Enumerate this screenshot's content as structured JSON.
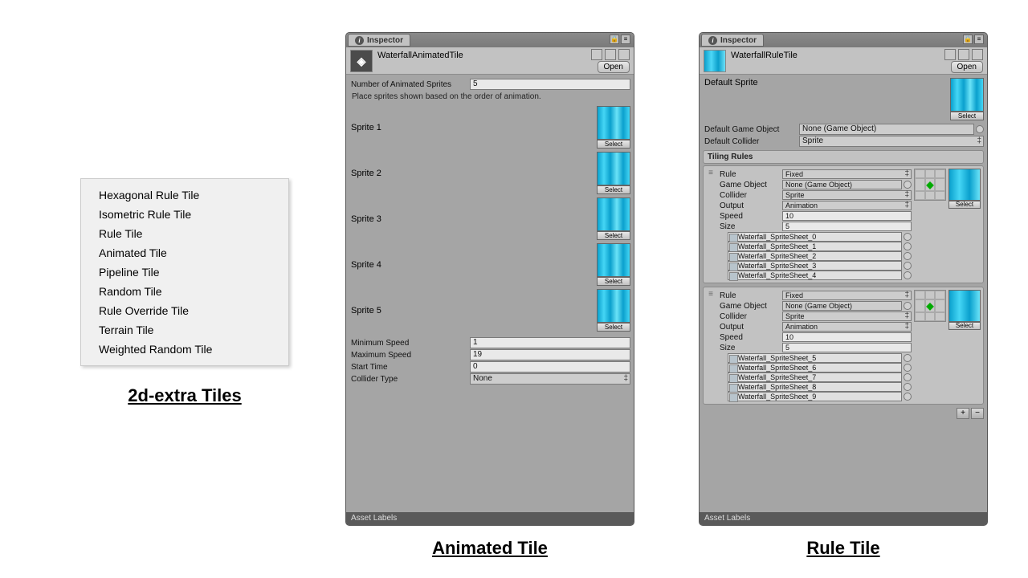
{
  "menu": {
    "items": [
      "Hexagonal Rule Tile",
      "Isometric Rule Tile",
      "Rule Tile",
      "Animated Tile",
      "Pipeline Tile",
      "Random Tile",
      "Rule Override Tile",
      "Terrain Tile",
      "Weighted Random Tile"
    ]
  },
  "captions": {
    "menu": "2d-extra Tiles",
    "anim": "Animated Tile",
    "rule": "Rule Tile"
  },
  "common": {
    "inspector_tab": "Inspector",
    "open": "Open",
    "select": "Select",
    "asset_labels": "Asset Labels"
  },
  "anim": {
    "asset_name": "WaterfallAnimatedTile",
    "num_label": "Number of Animated Sprites",
    "num_value": "5",
    "note": "Place sprites shown based on the order of animation.",
    "sprites": [
      "Sprite 1",
      "Sprite 2",
      "Sprite 3",
      "Sprite 4",
      "Sprite 5"
    ],
    "fields": {
      "min_speed": {
        "label": "Minimum Speed",
        "value": "1"
      },
      "max_speed": {
        "label": "Maximum Speed",
        "value": "19"
      },
      "start_time": {
        "label": "Start Time",
        "value": "0"
      },
      "collider": {
        "label": "Collider Type",
        "value": "None"
      }
    }
  },
  "rule": {
    "asset_name": "WaterfallRuleTile",
    "default_sprite_label": "Default Sprite",
    "default_game_object": {
      "label": "Default Game Object",
      "value": "None (Game Object)"
    },
    "default_collider": {
      "label": "Default Collider",
      "value": "Sprite"
    },
    "tiling_header": "Tiling Rules",
    "rules": [
      {
        "rule": "Fixed",
        "game_object": "None (Game Object)",
        "collider": "Sprite",
        "output": "Animation",
        "speed": "10",
        "size": "5",
        "sprites": [
          "Waterfall_SpriteSheet_0",
          "Waterfall_SpriteSheet_1",
          "Waterfall_SpriteSheet_2",
          "Waterfall_SpriteSheet_3",
          "Waterfall_SpriteSheet_4"
        ]
      },
      {
        "rule": "Fixed",
        "game_object": "None (Game Object)",
        "collider": "Sprite",
        "output": "Animation",
        "speed": "10",
        "size": "5",
        "sprites": [
          "Waterfall_SpriteSheet_5",
          "Waterfall_SpriteSheet_6",
          "Waterfall_SpriteSheet_7",
          "Waterfall_SpriteSheet_8",
          "Waterfall_SpriteSheet_9"
        ]
      }
    ],
    "labels": {
      "rule": "Rule",
      "game_object": "Game Object",
      "collider": "Collider",
      "output": "Output",
      "speed": "Speed",
      "size": "Size"
    }
  }
}
